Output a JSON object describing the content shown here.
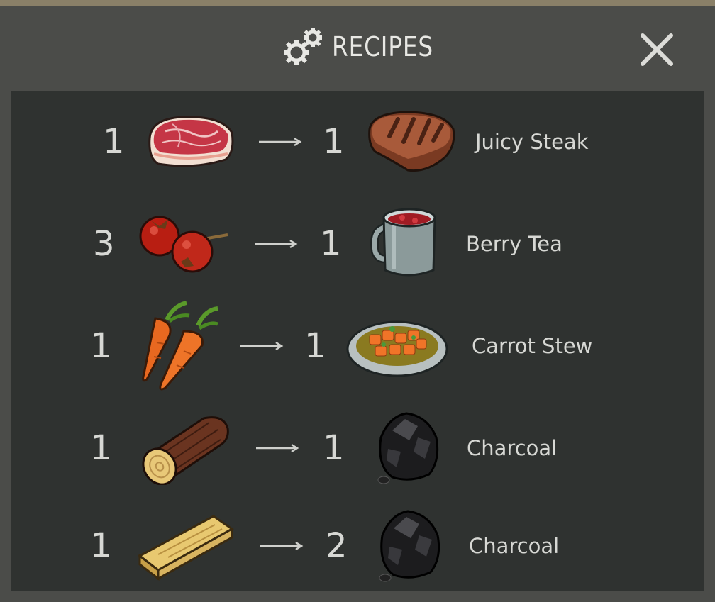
{
  "header": {
    "title": "RECIPES",
    "icon": "gears-icon",
    "close_icon": "close-icon"
  },
  "colors": {
    "background": "#4b4c49",
    "panel": "#2f3230",
    "text": "#d7d8d4",
    "accent_strip": "#8a8068"
  },
  "recipes": [
    {
      "input_qty": "1",
      "input_icon": "raw-meat-icon",
      "output_qty": "1",
      "output_icon": "steak-icon",
      "output_name": "Juicy Steak"
    },
    {
      "input_qty": "3",
      "input_icon": "berries-icon",
      "output_qty": "1",
      "output_icon": "tea-mug-icon",
      "output_name": "Berry Tea"
    },
    {
      "input_qty": "1",
      "input_icon": "carrots-icon",
      "output_qty": "1",
      "output_icon": "stew-bowl-icon",
      "output_name": "Carrot Stew"
    },
    {
      "input_qty": "1",
      "input_icon": "log-icon",
      "output_qty": "1",
      "output_icon": "charcoal-icon",
      "output_name": "Charcoal"
    },
    {
      "input_qty": "1",
      "input_icon": "plank-icon",
      "output_qty": "2",
      "output_icon": "charcoal-icon",
      "output_name": "Charcoal"
    }
  ]
}
